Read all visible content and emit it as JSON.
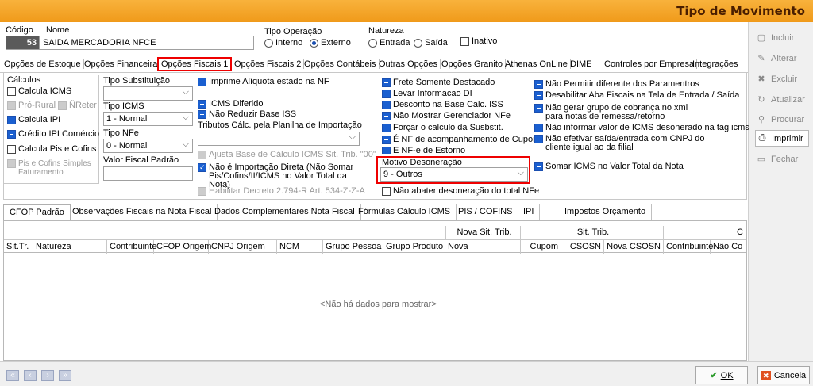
{
  "window": {
    "title": "Tipo de Movimento"
  },
  "side_buttons": [
    {
      "label": "Incluir",
      "icon": "new-doc-icon",
      "glyph": "▢",
      "active": false
    },
    {
      "label": "Alterar",
      "icon": "edit-icon",
      "glyph": "✎",
      "active": false
    },
    {
      "label": "Excluir",
      "icon": "delete-icon",
      "glyph": "✖",
      "active": false
    },
    {
      "label": "Atualizar",
      "icon": "refresh-icon",
      "glyph": "↻",
      "active": false
    },
    {
      "label": "Procurar",
      "icon": "binoculars-icon",
      "glyph": "⚲",
      "active": false
    },
    {
      "label": "Imprimir",
      "icon": "printer-icon",
      "glyph": "⎙",
      "active": true
    },
    {
      "label": "Fechar",
      "icon": "close-folder-icon",
      "glyph": "▭",
      "active": false
    }
  ],
  "header": {
    "codigo_label": "Código",
    "codigo_value": "53",
    "nome_label": "Nome",
    "nome_value": "SAIDA MERCADORIA NFCE",
    "tipo_op_label": "Tipo Operação",
    "tipo_op_options": [
      {
        "label": "Interno",
        "selected": false
      },
      {
        "label": "Externo",
        "selected": true
      }
    ],
    "natureza_label": "Natureza",
    "natureza_options": [
      {
        "label": "Entrada",
        "selected": false
      },
      {
        "label": "Saída",
        "selected": false
      }
    ],
    "inativo_label": "Inativo"
  },
  "tabs": [
    "Opções de Estoque",
    "Opções Financeiras",
    "Opções Fiscais 1",
    "Opções Fiscais 2",
    "Opções Contábeis",
    "Outras Opções",
    "Opções Granito",
    "Athenas OnLine",
    "DIME",
    "Controles por Empresa",
    "Integrações"
  ],
  "fiscal": {
    "calculos_label": "Cálculos",
    "calcula_icms": "Calcula ICMS",
    "pro_rural": "Pró-Rural",
    "nreter": "ÑReter",
    "calcula_ipi": "Calcula IPI",
    "credito_ipi": "Crédito IPI Comércio",
    "calcula_pis": "Calcula Pis e Cofins",
    "pis_simples": "Pis e Cofins Simples Faturamento",
    "tipo_subst_label": "Tipo Substituição",
    "tipo_subst_value": "",
    "tipo_icms_label": "Tipo ICMS",
    "tipo_icms_value": "1 - Normal",
    "tipo_nfe_label": "Tipo NFe",
    "tipo_nfe_value": "0 - Normal",
    "valor_fiscal_label": "Valor Fiscal Padrão",
    "valor_fiscal_value": "",
    "imprime_aliquota": "Imprime Alíquota estado na NF",
    "icms_diferido": "ICMS Diferido",
    "nao_reduzir": "Não Reduzir Base ISS",
    "tributos_label": "Tributos Cálc. pela Planilha de Importação",
    "tributos_value": "",
    "ajusta_base": "Ajusta Base de Cálculo ICMS Sit. Trib. \"00\"",
    "nao_importacao": "Não é Importação Direta (Não Somar Pis/Cofins/II/ICMS  no Valor Total da Nota)",
    "habilitar_decreto": "Habilitar Decreto 2.794-R Art. 534-Z-Z-A",
    "frete": "Frete Somente Destacado",
    "levar_info": "Levar Informacao DI",
    "desconto_base": "Desconto na Base Calc. ISS",
    "nao_mostrar": "Não Mostrar Gerenciador NFe",
    "forcar": "Forçar o calculo da Susbstit.",
    "nf_cupom": "É NF de acompanhamento de Cupom",
    "nfe_estorno": "É NF-e de Estorno",
    "motivo_label": "Motivo Desoneração",
    "motivo_value": "9 - Outros",
    "nao_abater": "Não abater desoneração do total NFe",
    "nao_permitir": "Não Permitir diferente dos Paramentros",
    "desabilitar_aba": "Desabilitar Aba Fiscais na Tela de Entrada / Saída",
    "nao_gerar": "Não gerar grupo de cobrança no xml para notas de remessa/retorno",
    "nao_informar": "Não informar valor de ICMS desonerado na tag icms",
    "nao_efetivar": "Não efetivar saída/entrada com CNPJ do cliente igual ao da filial",
    "somar_icms": "Somar ICMS no Valor Total da Nota"
  },
  "sub_tabs": [
    "CFOP Padrão",
    "Observações Fiscais na Nota Fiscal",
    "Dados Complementares Nota Fiscal",
    "Fórmulas Cálculo ICMS",
    "PIS / COFINS",
    "IPI",
    "Impostos Orçamento"
  ],
  "grid": {
    "band_nova_sit": "Nova Sit. Trib.",
    "band_sit": "Sit. Trib.",
    "band_c": "C",
    "columns": [
      "Sit.Tr.",
      "Natureza",
      "Contribuinte",
      "CFOP Origem",
      "CNPJ Origem",
      "NCM",
      "Grupo Pessoa",
      "Grupo Produto",
      "Nova",
      "Cupom",
      "CSOSN",
      "Nova CSOSN",
      "Contribuinte",
      "Não Co"
    ],
    "empty_text": "<Não há dados para mostrar>"
  },
  "footer": {
    "ok_label": "OK",
    "cancel_label": "Cancela"
  }
}
